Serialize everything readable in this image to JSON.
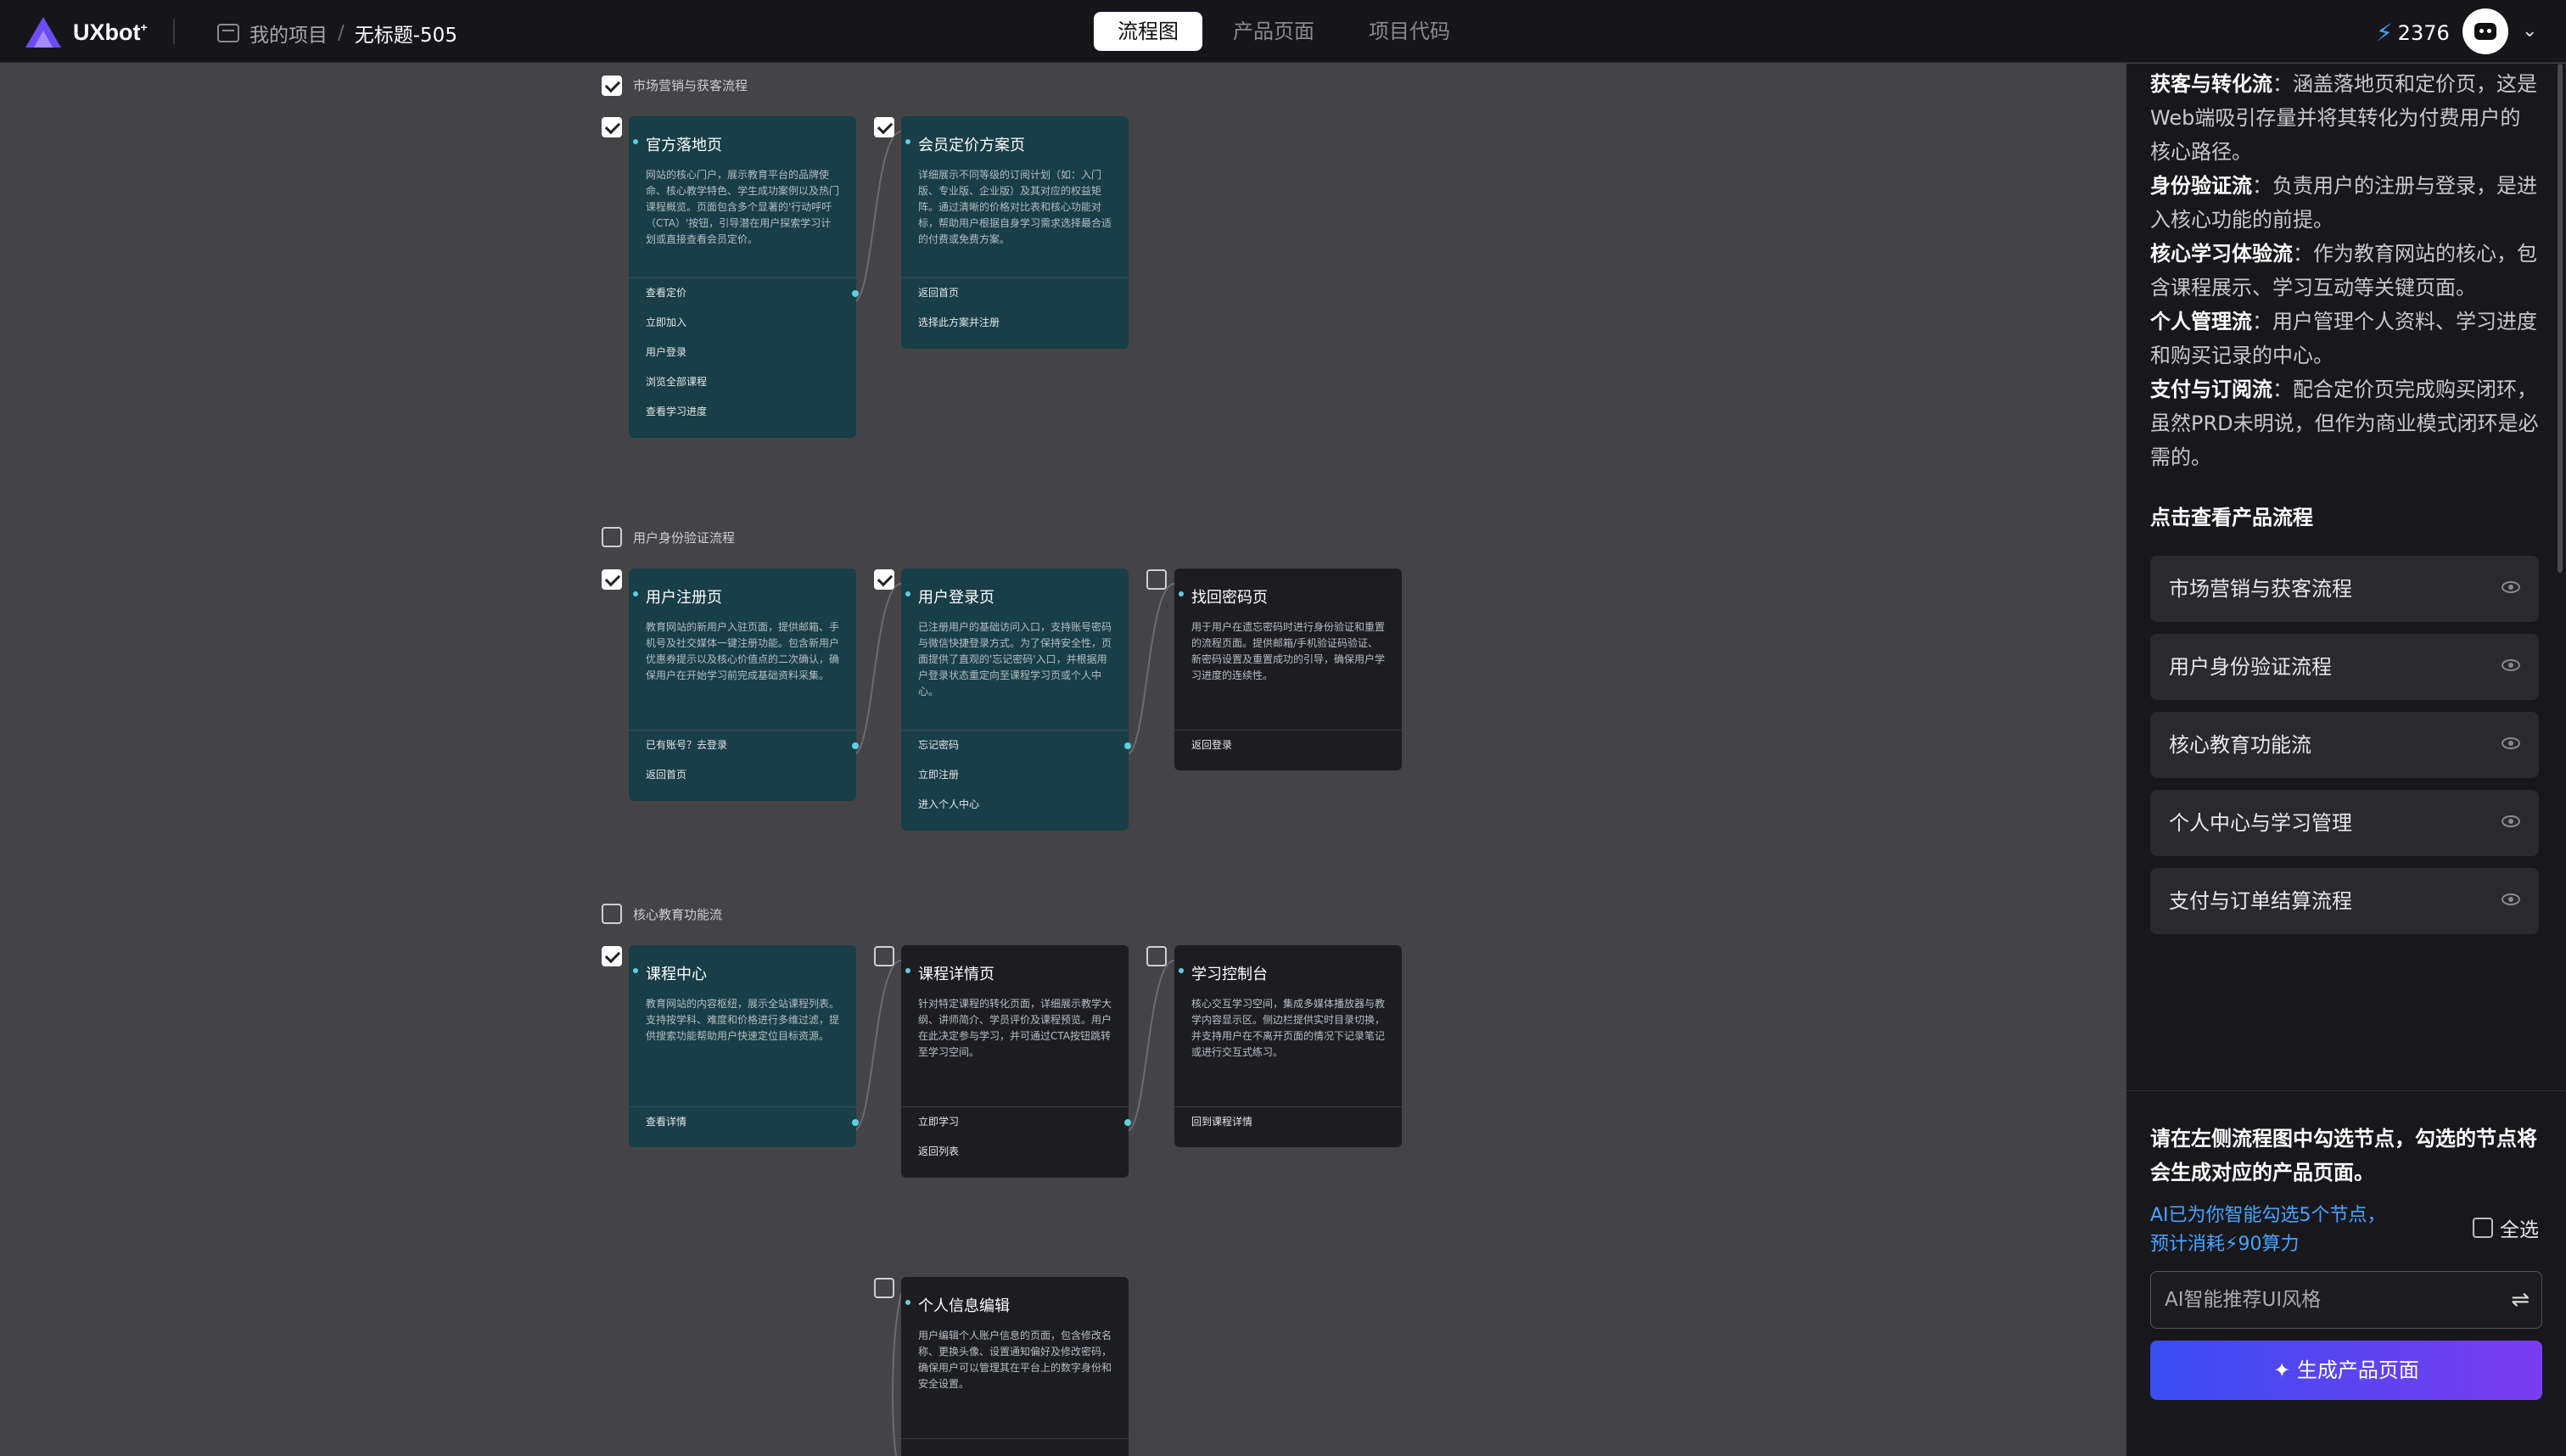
{
  "header": {
    "logo_text": "UXbot",
    "breadcrumb": {
      "project": "我的项目",
      "title": "无标题-505"
    },
    "tabs": [
      {
        "label": "流程图",
        "active": true
      },
      {
        "label": "产品页面",
        "active": false
      },
      {
        "label": "项目代码",
        "active": false
      }
    ],
    "credits": "2376"
  },
  "canvas": {
    "flows": [
      {
        "label": "市场营销与获客流程",
        "checked": true,
        "cards": [
          {
            "title": "官方落地页",
            "checked": true,
            "selected": true,
            "desc": "网站的核心门户，展示教育平台的品牌使命、核心教学特色、学生成功案例以及热门课程概览。页面包含多个显著的'行动呼吁（CTA）'按钮，引导潜在用户探索学习计划或直接查看会员定价。",
            "actions": [
              "查看定价",
              "立即加入",
              "用户登录",
              "浏览全部课程",
              "查看学习进度"
            ]
          },
          {
            "title": "会员定价方案页",
            "checked": true,
            "selected": true,
            "desc": "详细展示不同等级的订阅计划（如：入门版、专业版、企业版）及其对应的权益矩阵。通过清晰的价格对比表和核心功能对标，帮助用户根据自身学习需求选择最合适的付费或免费方案。",
            "actions": [
              "返回首页",
              "选择此方案并注册"
            ]
          }
        ]
      },
      {
        "label": "用户身份验证流程",
        "checked": false,
        "cards": [
          {
            "title": "用户注册页",
            "checked": true,
            "selected": true,
            "desc": "教育网站的新用户入驻页面，提供邮箱、手机号及社交媒体一键注册功能。包含新用户优惠券提示以及核心价值点的二次确认，确保用户在开始学习前完成基础资料采集。",
            "actions": [
              "已有账号？去登录",
              "返回首页"
            ]
          },
          {
            "title": "用户登录页",
            "checked": true,
            "selected": true,
            "desc": "已注册用户的基础访问入口，支持账号密码与微信快捷登录方式。为了保持安全性，页面提供了直观的'忘记密码'入口，并根据用户登录状态重定向至课程学习页或个人中心。",
            "actions": [
              "忘记密码",
              "立即注册",
              "进入个人中心"
            ]
          },
          {
            "title": "找回密码页",
            "checked": false,
            "selected": false,
            "desc": "用于用户在遗忘密码时进行身份验证和重置的流程页面。提供邮箱/手机验证码验证、新密码设置及重置成功的引导，确保用户学习进度的连续性。",
            "actions": [
              "返回登录"
            ]
          }
        ]
      },
      {
        "label": "核心教育功能流",
        "checked": false,
        "cards": [
          {
            "title": "课程中心",
            "checked": true,
            "selected": true,
            "desc": "教育网站的内容枢纽，展示全站课程列表。支持按学科、难度和价格进行多维过滤，提供搜索功能帮助用户快速定位目标资源。",
            "actions": [
              "查看详情"
            ]
          },
          {
            "title": "课程详情页",
            "checked": false,
            "selected": false,
            "desc": "针对特定课程的转化页面，详细展示教学大纲、讲师简介、学员评价及课程预览。用户在此决定参与学习，并可通过CTA按钮跳转至学习空间。",
            "actions": [
              "立即学习",
              "返回列表"
            ]
          },
          {
            "title": "学习控制台",
            "checked": false,
            "selected": false,
            "desc": "核心交互学习空间，集成多媒体播放器与教学内容显示区。侧边栏提供实时目录切换，并支持用户在不离开页面的情况下记录笔记或进行交互式练习。",
            "actions": [
              "回到课程详情"
            ]
          }
        ]
      },
      {
        "label": "",
        "checked": false,
        "cards": [
          {
            "title": "个人信息编辑",
            "checked": false,
            "selected": false,
            "desc": "用户编辑个人账户信息的页面，包含修改名称、更换头像、设置通知偏好及修改密码，确保用户可以管理其在平台上的数字身份和安全设置。",
            "actions": []
          }
        ]
      }
    ]
  },
  "panel": {
    "intro": [
      {
        "term": "获客与转化流",
        "text": "：涵盖落地页和定价页，这是Web端吸引存量并将其转化为付费用户的核心路径。"
      },
      {
        "term": "身份验证流",
        "text": "：负责用户的注册与登录，是进入核心功能的前提。"
      },
      {
        "term": "核心学习体验流",
        "text": "：作为教育网站的核心，包含课程展示、学习互动等关键页面。"
      },
      {
        "term": "个人管理流",
        "text": "：用户管理个人资料、学习进度和购买记录的中心。"
      },
      {
        "term": "支付与订阅流",
        "text": "：配合定价页完成购买闭环，虽然PRD未明说，但作为商业模式闭环是必需的。"
      }
    ],
    "flows_title": "点击查看产品流程",
    "flows": [
      "市场营销与获客流程",
      "用户身份验证流程",
      "核心教育功能流",
      "个人中心与学习管理",
      "支付与订单结算流程"
    ],
    "hint": "请在左侧流程图中勾选节点，勾选的节点将会生成对应的产品页面。",
    "ai_note_1": "AI已为你智能勾选5个节点，",
    "ai_note_2": "预计消耗",
    "ai_note_3": "90算力",
    "select_all": "全选",
    "style_placeholder": "AI智能推荐UI风格",
    "generate_label": "生成产品页面"
  },
  "colors": {
    "selected_card": "#183e48",
    "card": "#1d1d21",
    "accent": "#4aa3ff",
    "connector": "#5fd0e0"
  }
}
